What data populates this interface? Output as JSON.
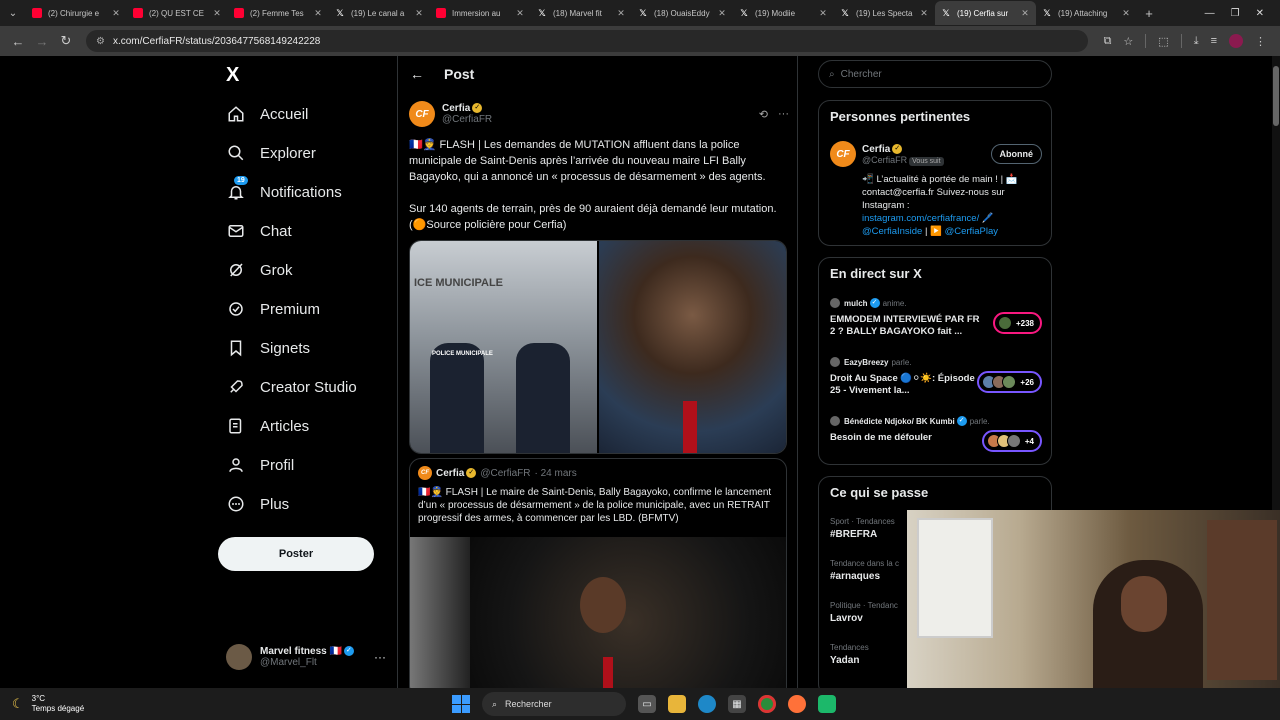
{
  "browser": {
    "tabs": [
      {
        "label": "(2) Chirurgie e",
        "favicon": "youtube-icon",
        "active": false
      },
      {
        "label": "(2) QU EST CE",
        "favicon": "youtube-icon",
        "active": false
      },
      {
        "label": "(2) Femme Tes",
        "favicon": "youtube-icon",
        "active": false
      },
      {
        "label": "(19) Le canal a",
        "favicon": "x-icon",
        "active": false
      },
      {
        "label": "Immersion au",
        "favicon": "youtube-icon",
        "active": false
      },
      {
        "label": "(18) Marvel fit",
        "favicon": "x-icon",
        "active": false
      },
      {
        "label": "(18) OuaisEddy",
        "favicon": "x-icon",
        "active": false
      },
      {
        "label": "(19) Modiie",
        "favicon": "x-icon",
        "active": false
      },
      {
        "label": "(19) Les Specta",
        "favicon": "x-icon",
        "active": false
      },
      {
        "label": "(19) Cerfia sur",
        "favicon": "x-icon",
        "active": true
      },
      {
        "label": "(19) Attaching",
        "favicon": "x-icon",
        "active": false
      }
    ],
    "url": "x.com/CerfiaFR/status/2036477568149242228"
  },
  "sidebar": {
    "logo": "X",
    "items": [
      {
        "label": "Accueil",
        "icon": "home-icon"
      },
      {
        "label": "Explorer",
        "icon": "search-icon"
      },
      {
        "label": "Notifications",
        "icon": "bell-icon",
        "badge": "19"
      },
      {
        "label": "Chat",
        "icon": "envelope-icon"
      },
      {
        "label": "Grok",
        "icon": "grok-icon"
      },
      {
        "label": "Premium",
        "icon": "premium-icon"
      },
      {
        "label": "Signets",
        "icon": "bookmark-icon"
      },
      {
        "label": "Creator Studio",
        "icon": "rocket-icon"
      },
      {
        "label": "Articles",
        "icon": "articles-icon"
      },
      {
        "label": "Profil",
        "icon": "person-icon"
      },
      {
        "label": "Plus",
        "icon": "more-circle-icon"
      }
    ],
    "post_button": "Poster",
    "account": {
      "display_name": "Marvel fitness 🇫🇷",
      "handle": "@Marvel_Flt"
    }
  },
  "main": {
    "header_title": "Post",
    "post": {
      "author_name": "Cerfia",
      "author_handle": "@CerfiaFR",
      "paragraph1": "🇫🇷👮 FLASH | Les demandes de MUTATION affluent dans la police municipale de Saint-Denis après l’arrivée du nouveau maire LFI Bally Bagayoko, qui a annoncé un « processus de désarmement » des agents.",
      "paragraph2": "Sur 140 agents de terrain, près de 90 auraient déjà demandé leur mutation. (🟠Source policière pour Cerfia)",
      "image_left_caption": "ICE MUNICIPALE",
      "image_left_vest": "POLICE MUNICIPALE"
    },
    "quote": {
      "author_name": "Cerfia",
      "author_handle": "@CerfiaFR",
      "date": "· 24 mars",
      "text": "🇫🇷👮 FLASH | Le maire de Saint-Denis, Bally Bagayoko, confirme le lancement d’un « processus de désarmement » de la police municipale, avec un RETRAIT progressif des armes, à commencer par les LBD. (BFMTV)"
    }
  },
  "right": {
    "search_placeholder": "Chercher",
    "relevant": {
      "title": "Personnes pertinentes",
      "name": "Cerfia",
      "handle": "@CerfiaFR",
      "follows_you": "Vous suit",
      "follow_label": "Abonné",
      "bio_line1": "📲 L’actualité à portée de main ! | 📩",
      "bio_line2": "contact@cerfia.fr Suivez-nous sur",
      "bio_line3": "Instagram :",
      "bio_link1": "instagram.com/cerfiafrance/",
      "bio_line4_suffix": " 🖊️",
      "bio_link2": "@CerfiaInside",
      "bio_sep": " | ▶️ ",
      "bio_link3": "@CerfiaPlay"
    },
    "live": {
      "title": "En direct sur X",
      "items": [
        {
          "host": "mulch",
          "action": "anime.",
          "title": "EMMODEM INTERVIEWÉ PAR FR 2 ? BALLY BAGAYOKO fait ...",
          "listeners": "+238",
          "border": "#f91880"
        },
        {
          "host": "EazyBreezy",
          "action": "parle.",
          "title": "Droit Au Space 🔵⚪☀️: Épisode 25 - Vivement la...",
          "listeners": "+26",
          "border": "#7856ff"
        },
        {
          "host": "Bénédicte Ndjoko/ BK Kumbi",
          "action": "parle.",
          "title": "Besoin de me défouler",
          "listeners": "+4",
          "border": "#7856ff"
        }
      ]
    },
    "trends": {
      "title": "Ce qui se passe",
      "items": [
        {
          "category": "Sport · Tendances",
          "name": "#BREFRA"
        },
        {
          "category": "Tendance dans la c",
          "name": "#arnaques"
        },
        {
          "category": "Politique · Tendanc",
          "name": "Lavrov"
        },
        {
          "category": "Tendances",
          "name": "Yadan"
        }
      ]
    }
  },
  "taskbar": {
    "temperature": "3°C",
    "weather": "Temps dégagé",
    "search_label": "Rechercher"
  },
  "colors": {
    "accent": "#1d9bf0",
    "verified_gold": "#e8b82e",
    "cerfia_orange": "#f08a1a"
  }
}
